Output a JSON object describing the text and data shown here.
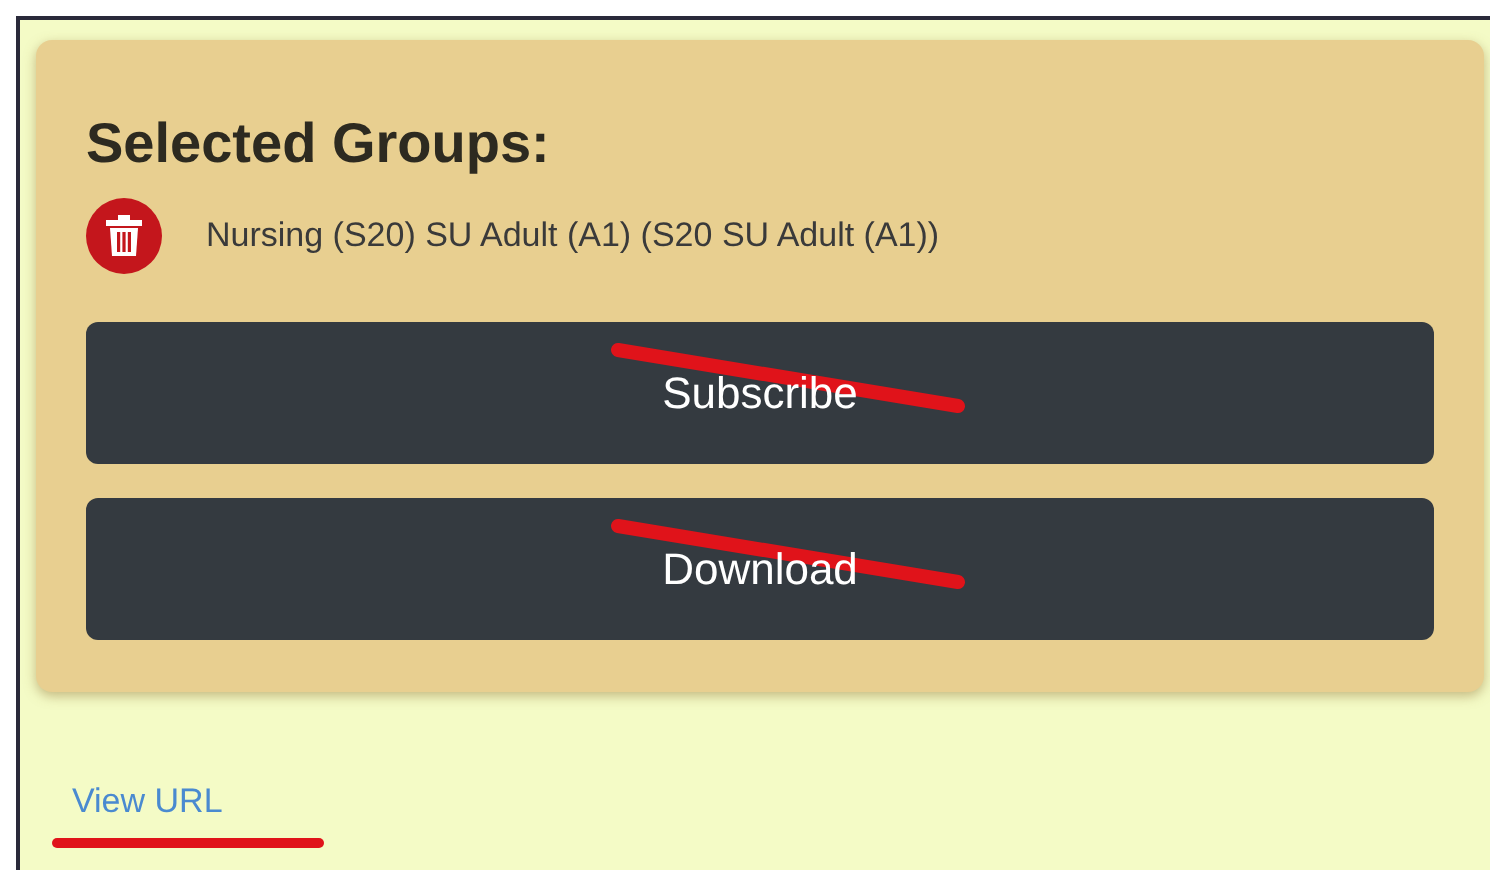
{
  "card": {
    "title": "Selected Groups:",
    "groups": [
      {
        "name": "Nursing (S20) SU Adult (A1) (S20 SU Adult (A1))"
      }
    ],
    "buttons": [
      {
        "label": "Subscribe",
        "struck": true
      },
      {
        "label": "Download",
        "struck": true
      }
    ]
  },
  "link": {
    "label": "View URL",
    "underlined": true
  }
}
